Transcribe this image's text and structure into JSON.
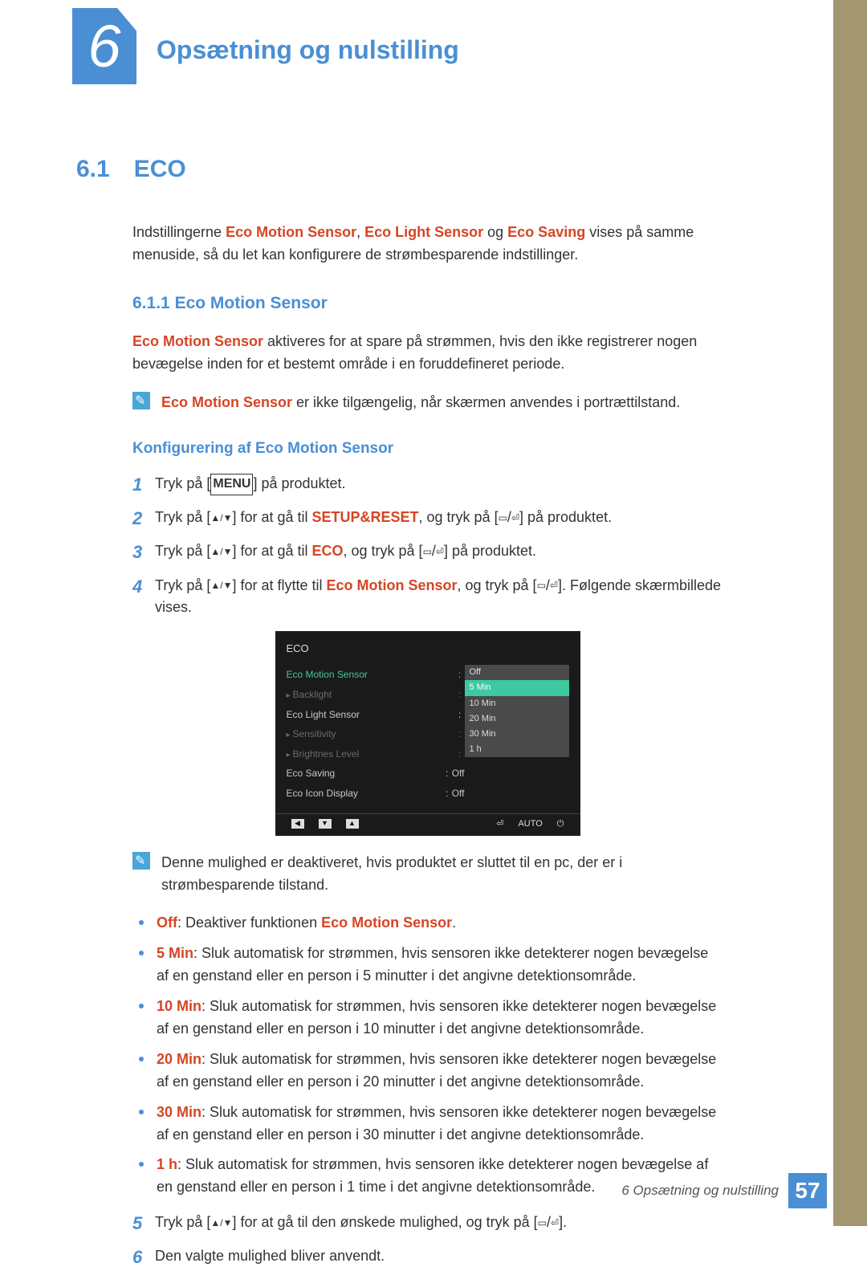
{
  "chapter": {
    "num": "6",
    "title": "Opsætning og nulstilling"
  },
  "section": {
    "num": "6.1",
    "title": "ECO"
  },
  "intro": {
    "pre": "Indstillingerne ",
    "t1": "Eco Motion Sensor",
    "sep1": ", ",
    "t2": "Eco Light Sensor",
    "sep2": " og ",
    "t3": "Eco Saving",
    "post": " vises på samme menuside, så du let kan konfigurere de strømbesparende indstillinger."
  },
  "subsection": {
    "num": "6.1.1",
    "title": "Eco Motion Sensor"
  },
  "desc": {
    "term": "Eco Motion Sensor",
    "text": " aktiveres for at spare på strømmen, hvis den ikke registrerer nogen bevægelse inden for et bestemt område i en foruddefineret periode."
  },
  "note1": {
    "term": "Eco Motion Sensor",
    "text": " er ikke tilgængelig, når skærmen anvendes i portrættilstand."
  },
  "subhead": "Konfigurering af Eco Motion Sensor",
  "steps": [
    {
      "n": "1",
      "pre": "Tryk på [",
      "key": "MENU",
      "post": "] på produktet."
    },
    {
      "n": "2",
      "pre": "Tryk på [",
      "sym": "▲/▼",
      "mid1": "] for at gå til ",
      "term": "SETUP&RESET",
      "mid2": ", og tryk på [",
      "icons": true,
      "post": "] på produktet."
    },
    {
      "n": "3",
      "pre": "Tryk på [",
      "sym": "▲/▼",
      "mid1": "] for at gå til ",
      "term": "ECO",
      "mid2": ", og tryk på [",
      "icons": true,
      "post": "] på produktet."
    },
    {
      "n": "4",
      "pre": "Tryk på [",
      "sym": "▲/▼",
      "mid1": "] for at flytte til ",
      "term": "Eco Motion Sensor",
      "mid2": ", og tryk på [",
      "icons": true,
      "post": "]. Følgende skærmbillede vises."
    }
  ],
  "osd": {
    "title": "ECO",
    "menu": [
      {
        "label": "Eco Motion Sensor",
        "selected": true
      },
      {
        "label": "Backlight",
        "dim": true,
        "indent": true
      },
      {
        "label": "Eco Light Sensor"
      },
      {
        "label": "Sensitivity",
        "dim": true,
        "indent": true
      },
      {
        "label": "Brightnes Level",
        "dim": true,
        "indent": true
      },
      {
        "label": "Eco Saving",
        "value": "Off"
      },
      {
        "label": "Eco Icon Display",
        "value": "Off"
      }
    ],
    "options": [
      "Off",
      "5 Min",
      "10 Min",
      "20 Min",
      "30 Min",
      "1 h"
    ],
    "highlight": "5 Min",
    "footer": {
      "b1": "◀",
      "b2": "▼",
      "b3": "▲",
      "enter": "⏎",
      "auto": "AUTO",
      "power": "⏻"
    }
  },
  "note2": "Denne mulighed er deaktiveret, hvis produktet er sluttet til en pc, der er i strømbesparende tilstand.",
  "bullets": [
    {
      "term": "Off",
      "sep": ": ",
      "text1": "Deaktiver funktionen ",
      "term2": "Eco Motion Sensor",
      "text2": "."
    },
    {
      "term": "5 Min",
      "sep": ": ",
      "text1": "Sluk automatisk for strømmen, hvis sensoren ikke detekterer nogen bevægelse af en genstand eller en person i 5 minutter i det angivne detektionsområde."
    },
    {
      "term": "10 Min",
      "sep": ": ",
      "text1": "Sluk automatisk for strømmen, hvis sensoren ikke detekterer nogen bevægelse af en genstand eller en person i 10 minutter i det angivne detektionsområde."
    },
    {
      "term": "20 Min",
      "sep": ": ",
      "text1": "Sluk automatisk for strømmen, hvis sensoren ikke detekterer nogen bevægelse af en genstand eller en person i 20 minutter i det angivne detektionsområde."
    },
    {
      "term": "30 Min",
      "sep": ": ",
      "text1": "Sluk automatisk for strømmen, hvis sensoren ikke detekterer nogen bevægelse af en genstand eller en person i 30 minutter i det angivne detektionsområde."
    },
    {
      "term": "1 h",
      "sep": ": ",
      "text1": "Sluk automatisk for strømmen, hvis sensoren ikke detekterer nogen bevægelse af en genstand eller en person i 1 time i det angivne detektionsområde."
    }
  ],
  "steps_after": [
    {
      "n": "5",
      "pre": "Tryk på [",
      "sym": "▲/▼",
      "mid1": "] for at gå til den ønskede mulighed, og tryk på [",
      "icons": true,
      "post": "]."
    },
    {
      "n": "6",
      "text": "Den valgte mulighed bliver anvendt."
    }
  ],
  "footer": {
    "text": "6 Opsætning og nulstilling",
    "page": "57"
  }
}
